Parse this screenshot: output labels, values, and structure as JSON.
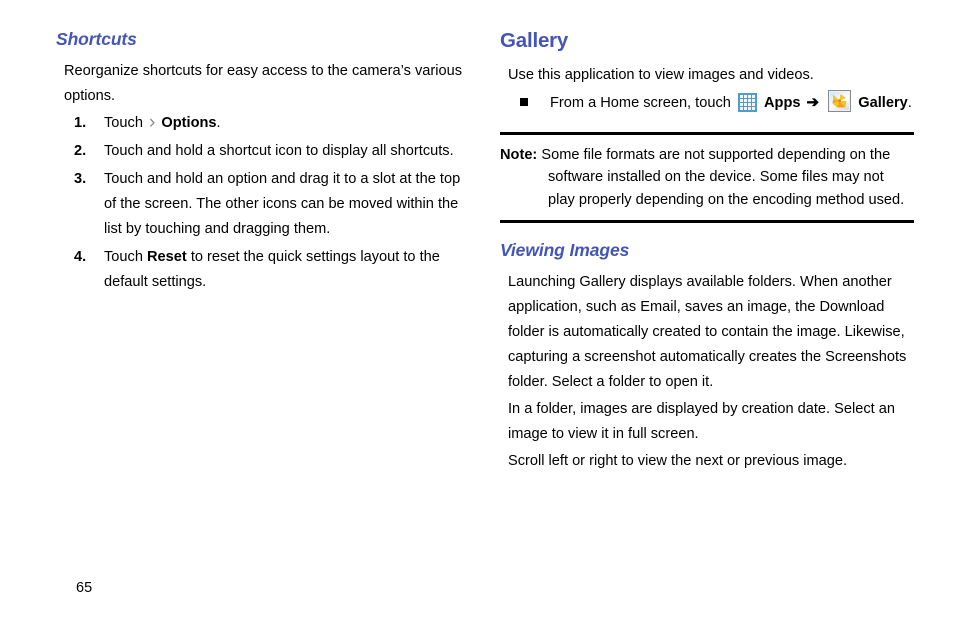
{
  "page": {
    "number": "65",
    "heading_color": "#4355b5"
  },
  "left_column": {
    "heading": "Shortcuts",
    "intro": "Reorganize shortcuts for easy access to the camera’s various options.",
    "steps": [
      {
        "marker": "1.",
        "pre": "Touch",
        "chevron": "›",
        "bold": "Options",
        "post": "."
      },
      {
        "marker": "2.",
        "text": "Touch and hold a shortcut icon to display all shortcuts."
      },
      {
        "marker": "3.",
        "text": "Touch and hold an option and drag it to a slot at the top of the screen. The other icons can be moved within the list by touching and dragging them."
      },
      {
        "marker": "4.",
        "pre": "Touch",
        "bold": "Reset",
        "post": "to reset the quick settings layout to the default settings."
      }
    ]
  },
  "right_column": {
    "heading": "Gallery",
    "intro": "Use this application to view images and videos.",
    "bullet": {
      "pre": "From a Home screen, touch",
      "apps_icon": "apps-grid-icon",
      "apps_label": "Apps",
      "arrow": "➔",
      "gallery_icon": "gallery-flower-icon",
      "gallery_label": "Gallery",
      "post": "."
    },
    "note": {
      "label": "Note:",
      "lines": [
        "Some file formats are not supported depending on the",
        "software installed on the device. Some files may not",
        "play properly depending on the encoding method used."
      ]
    },
    "subsection": {
      "heading": "Viewing Images",
      "paragraphs": [
        "Launching Gallery displays available folders. When another application, such as Email, saves an image, the Download folder is automatically created to contain the image. Likewise, capturing a screenshot automatically creates the Screenshots folder. Select a folder to open it.",
        "In a folder, images are displayed by creation date. Select an image to view it in full screen.",
        "Scroll left or right to view the next or previous image."
      ]
    }
  }
}
